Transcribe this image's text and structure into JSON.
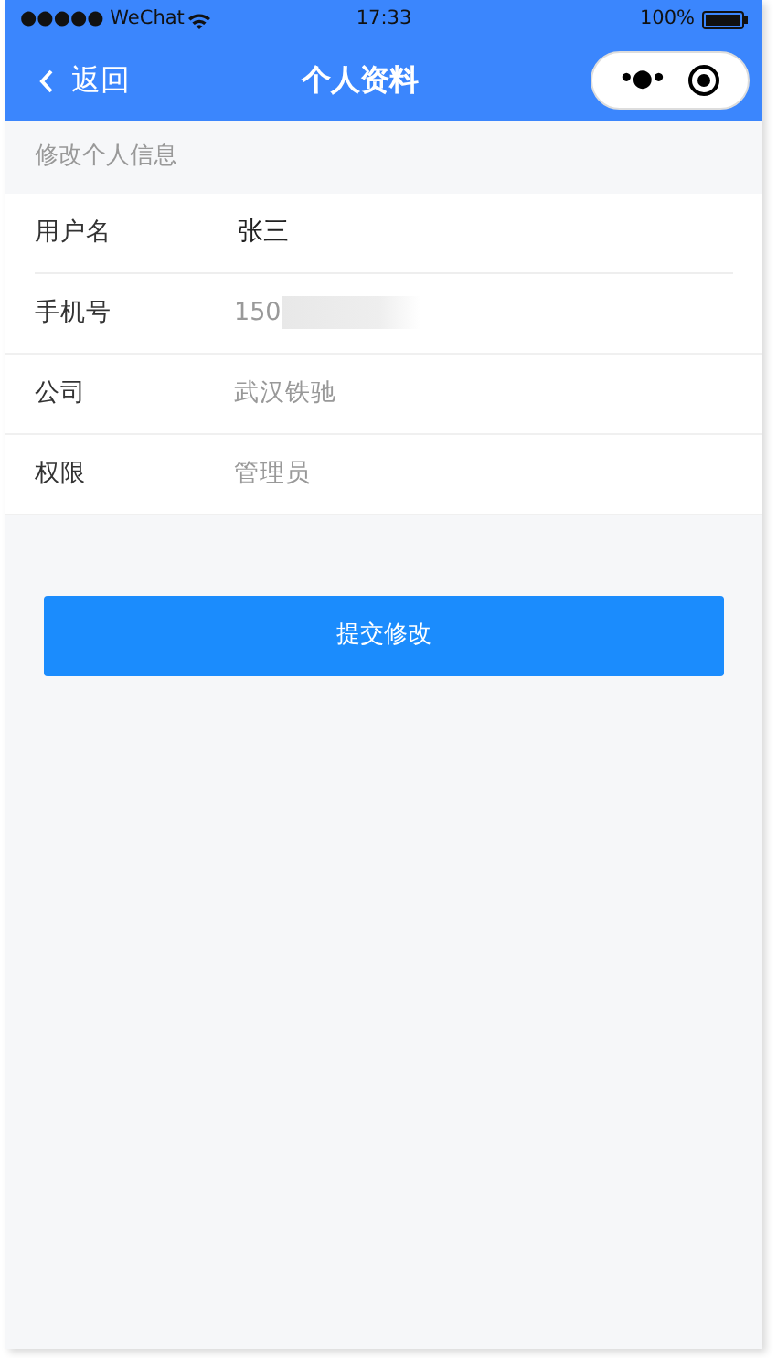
{
  "status_bar": {
    "carrier": "●●●●● WeChat",
    "time": "17:33",
    "battery": "100%"
  },
  "nav_bar": {
    "back": "返回",
    "title": "个人资料",
    "capsule_menu": "•●•"
  },
  "section_header": "修改个人信息",
  "fields": [
    {
      "label": "用户名",
      "value": "张三",
      "editable": true,
      "redacted": false
    },
    {
      "label": "手机号",
      "value": "150",
      "editable": false,
      "redacted": true
    },
    {
      "label": "公司",
      "value": "武汉铁驰",
      "editable": false,
      "redacted": false
    },
    {
      "label": "权限",
      "value": "管理员",
      "editable": false,
      "redacted": false
    }
  ],
  "submit_button": "提交修改"
}
